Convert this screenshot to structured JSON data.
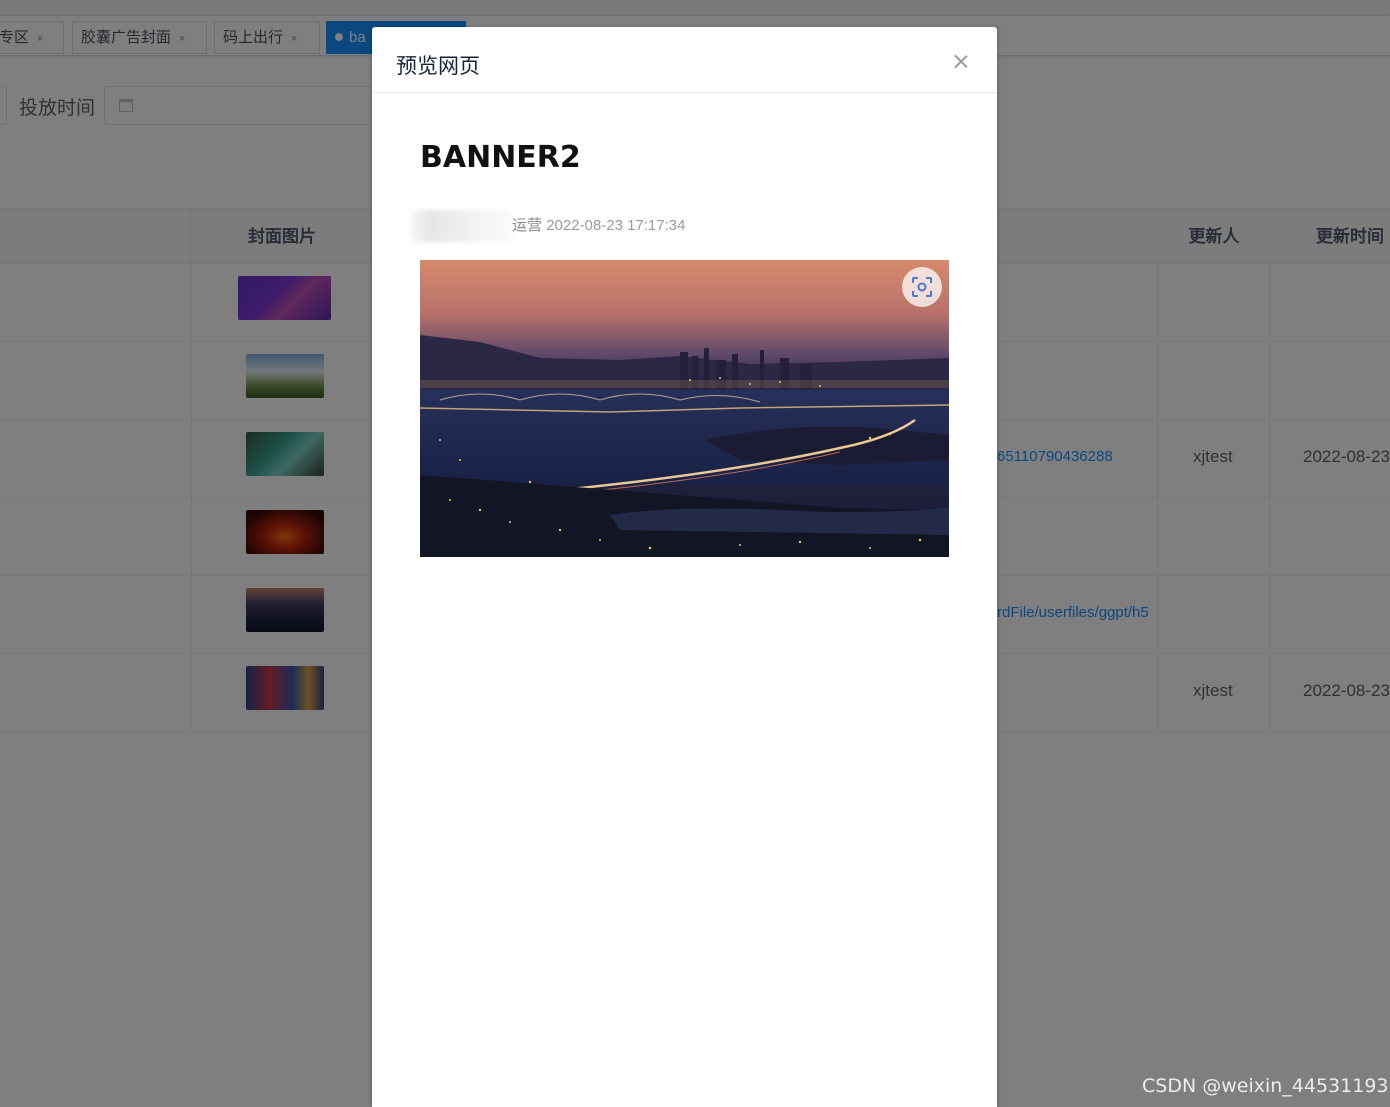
{
  "tabs": [
    {
      "label": "专区",
      "close": "×"
    },
    {
      "label": "胶囊广告封面",
      "close": "×"
    },
    {
      "label": "码上出行",
      "close": "×"
    },
    {
      "label": "ba",
      "close": ""
    }
  ],
  "filter": {
    "label": "投放时间",
    "date_placeholder": ""
  },
  "table": {
    "headers": {
      "cover": "封面图片",
      "updater": "更新人",
      "updated_at": "更新时间"
    },
    "rows": [
      {
        "link": "",
        "updater": "",
        "updated_at": ""
      },
      {
        "link": "",
        "updater": "",
        "updated_at": ""
      },
      {
        "link": "65110790436288",
        "updater": "xjtest",
        "updated_at": "2022-08-23"
      },
      {
        "link": "",
        "updater": "",
        "updated_at": ""
      },
      {
        "link": "rdFile/userfiles/ggpt/h5",
        "updater": "",
        "updated_at": ""
      },
      {
        "link": "",
        "updater": "xjtest",
        "updated_at": "2022-08-23"
      }
    ]
  },
  "dialog": {
    "title": "预览网页",
    "close_icon": "close-icon",
    "article": {
      "title": "BANNER2",
      "org": "运营",
      "timestamp": "2022-08-23 17:17:34"
    },
    "scan_icon": "scan-icon"
  },
  "watermark": "CSDN @weixin_44531193",
  "colors": {
    "primary": "#1890ff",
    "overlay": "rgba(0,0,0,0.5)"
  }
}
